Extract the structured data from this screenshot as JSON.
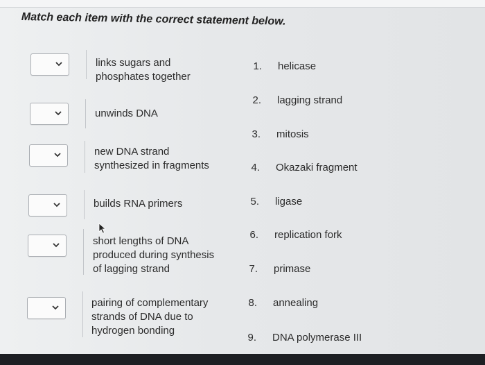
{
  "instruction": "Match each item with the correct statement below.",
  "statements": [
    {
      "lines": [
        "links sugars and",
        "phosphates together"
      ],
      "selected": ""
    },
    {
      "lines": [
        "unwinds DNA"
      ],
      "selected": ""
    },
    {
      "lines": [
        "new DNA strand",
        "synthesized in fragments"
      ],
      "selected": ""
    },
    {
      "lines": [
        "builds RNA primers"
      ],
      "selected": ""
    },
    {
      "lines": [
        "short lengths of DNA",
        "produced during synthesis",
        "of lagging strand"
      ],
      "selected": ""
    },
    {
      "lines": [
        "pairing of complementary",
        "strands of DNA due to",
        "hydrogen bonding"
      ],
      "selected": ""
    }
  ],
  "options": [
    {
      "number": "1.",
      "term": "helicase"
    },
    {
      "number": "2.",
      "term": "lagging strand"
    },
    {
      "number": "3.",
      "term": "mitosis"
    },
    {
      "number": "4.",
      "term": "Okazaki fragment"
    },
    {
      "number": "5.",
      "term": "ligase"
    },
    {
      "number": "6.",
      "term": "replication fork"
    },
    {
      "number": "7.",
      "term": "primase"
    },
    {
      "number": "8.",
      "term": "annealing"
    },
    {
      "number": "9.",
      "term": "DNA polymerase III"
    }
  ],
  "icons": {
    "dropdown": "chevron-down-icon",
    "cursor": "mouse-pointer-icon"
  }
}
